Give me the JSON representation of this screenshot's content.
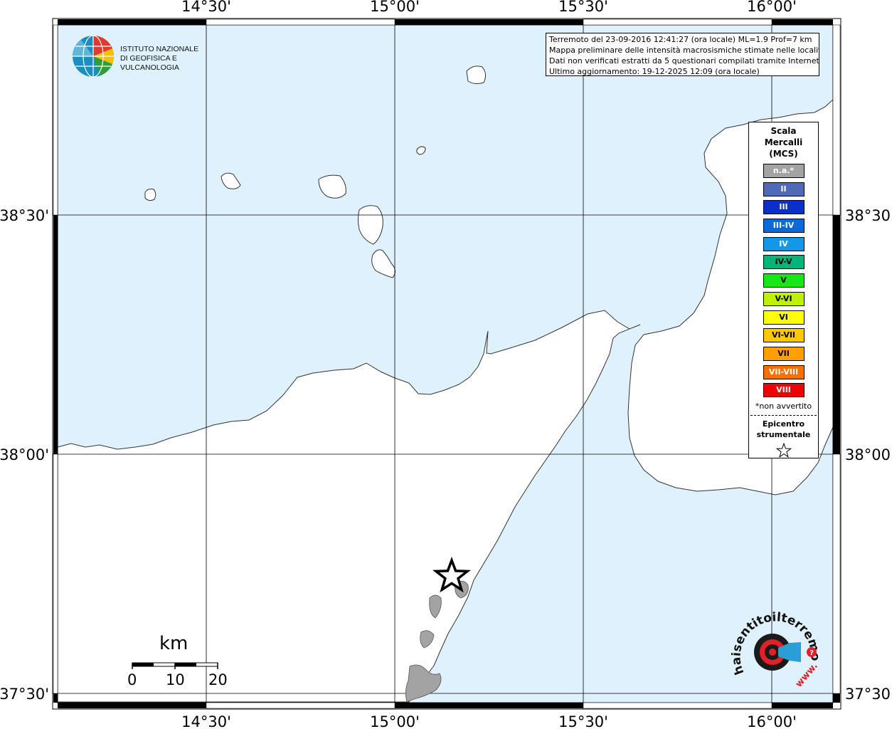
{
  "map": {
    "lon_ticks": [
      "14°30'",
      "15°00'",
      "15°30'",
      "16°00'"
    ],
    "lat_ticks": [
      "38°30'",
      "38°00'",
      "37°30'"
    ],
    "sea_color": "#dff1fc",
    "land_color": "#ffffff",
    "felt_area_color": "#a3a3a3"
  },
  "info": {
    "line1": "Terremoto del 23-09-2016 12:41:27 (ora locale) ML=1.9 Prof=7 km",
    "line2": "Mappa preliminare delle intensità macrosismiche stimate nelle località",
    "line3": "Dati non verificati estratti da 5 questionari compilati tramite Internet.",
    "line4": "Ultimo aggiornamento: 19-12-2025 12:09 (ora locale)"
  },
  "legend": {
    "title_line1": "Scala",
    "title_line2": "Mercalli",
    "title_line3": "(MCS)",
    "items": [
      {
        "label": "n.a.*",
        "color": "#a3a3a3"
      },
      {
        "label": "II",
        "color": "#4f6bb8"
      },
      {
        "label": "III",
        "color": "#0a30c8"
      },
      {
        "label": "III-IV",
        "color": "#0a6ad8"
      },
      {
        "label": "IV",
        "color": "#1298e6"
      },
      {
        "label": "IV-V",
        "color": "#00b57a"
      },
      {
        "label": "V",
        "color": "#19e619"
      },
      {
        "label": "V-VI",
        "color": "#bef000"
      },
      {
        "label": "VI",
        "color": "#ffff00"
      },
      {
        "label": "VI-VII",
        "color": "#ffc800"
      },
      {
        "label": "VII",
        "color": "#ffa000"
      },
      {
        "label": "VII-VIII",
        "color": "#ff6e00"
      },
      {
        "label": "VIII",
        "color": "#f00000"
      }
    ],
    "note": "*non avvertito",
    "epicenter_line1": "Epicentro",
    "epicenter_line2": "strumentale"
  },
  "scale": {
    "unit": "km",
    "labels": [
      "0",
      "10",
      "20"
    ]
  },
  "logos": {
    "ingv_line1": "Istituto Nazionale",
    "ingv_line2": "di Geofisica e Vulcanologia",
    "hst_text": "haisentitoilterremoto.it",
    "hst_www": "www."
  }
}
